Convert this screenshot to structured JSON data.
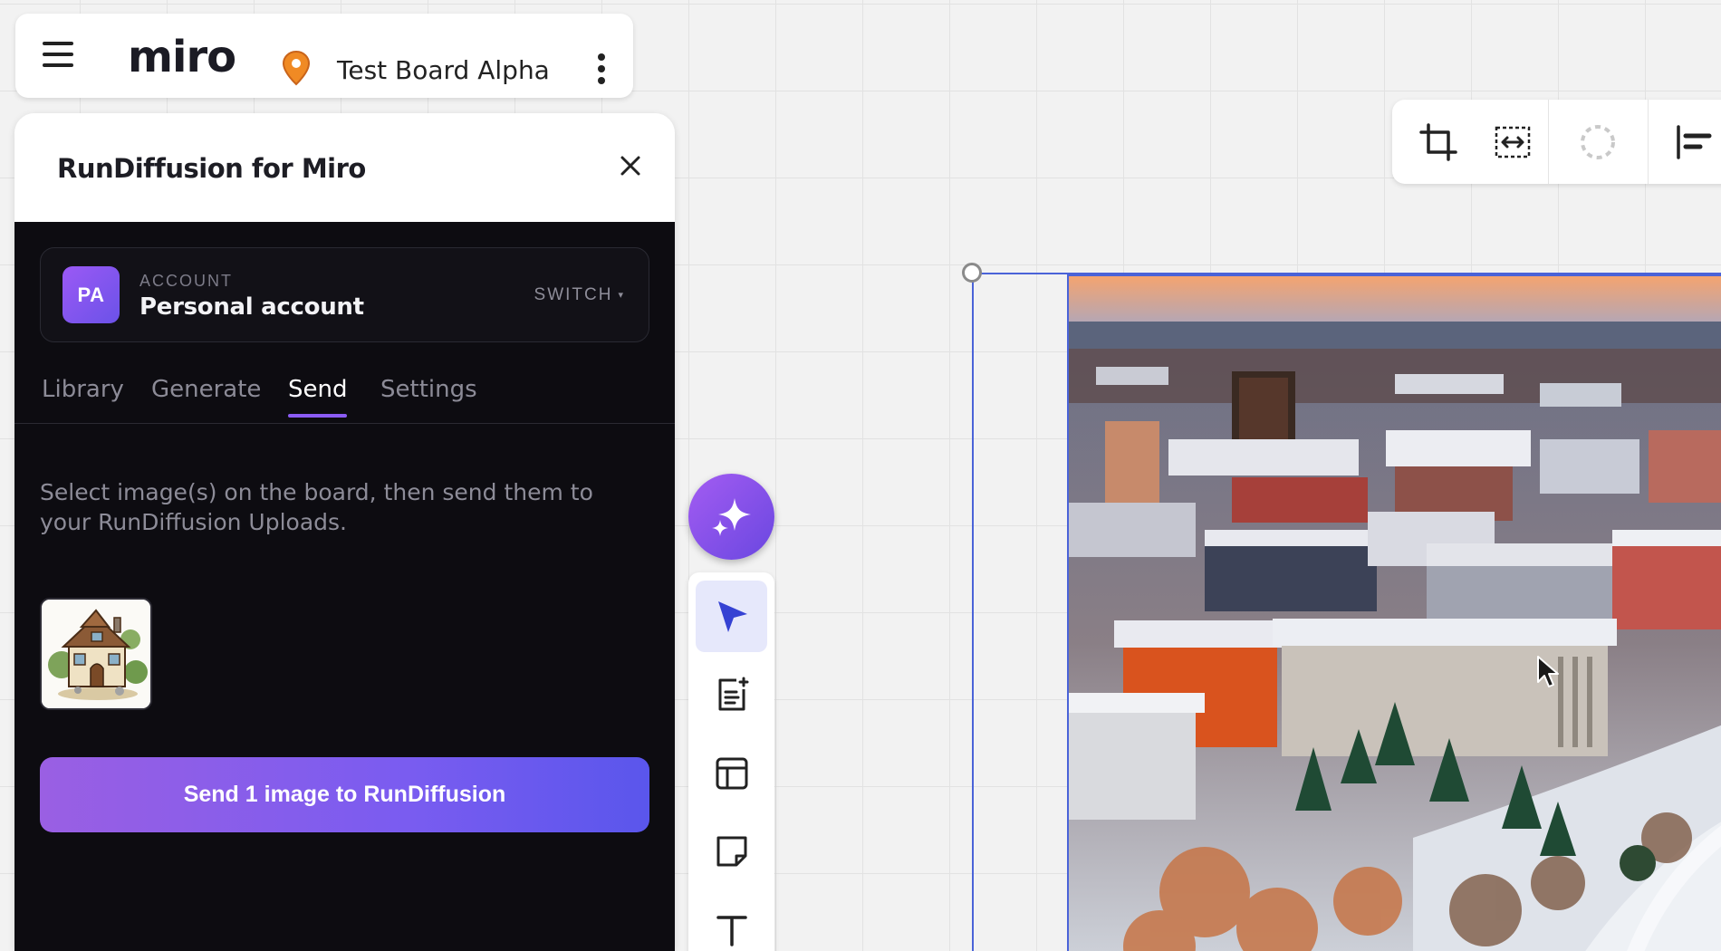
{
  "topbar": {
    "logo": "miro",
    "board_title": "Test Board Alpha",
    "icons": [
      "menu-icon",
      "location-pin-icon",
      "more-vertical-icon"
    ]
  },
  "panel": {
    "title": "RunDiffusion for Miro",
    "account": {
      "initials": "PA",
      "label": "ACCOUNT",
      "name": "Personal account",
      "switch_label": "SWITCH",
      "switch_caret": "▾"
    },
    "tabs": [
      {
        "label": "Library"
      },
      {
        "label": "Generate"
      },
      {
        "label": "Send"
      },
      {
        "label": "Settings"
      }
    ],
    "active_tab": "Send",
    "instructions": "Select image(s) on the board, then send them to your RunDiffusion Uploads.",
    "selected_count": 1,
    "send_button": "Send 1 image to RunDiffusion"
  },
  "toolbar": {
    "tools": [
      "ai-sparkle",
      "select",
      "add-doc",
      "templates",
      "sticky-note",
      "text"
    ],
    "active_tool": "select"
  },
  "context_toolbar": {
    "buttons": [
      "crop",
      "fit-width",
      "loading",
      "align"
    ]
  },
  "colors": {
    "accent": "#8b5cf6",
    "selection": "#4a63d8",
    "panel_bg": "#0d0c11",
    "pin": "#f08a24"
  }
}
